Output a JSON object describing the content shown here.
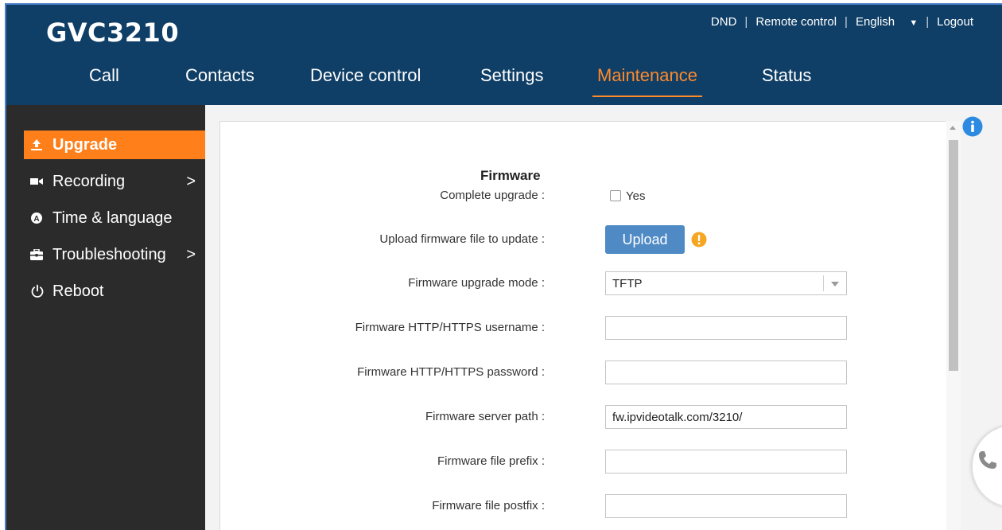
{
  "app": {
    "logo": "GVC3210"
  },
  "top_links": {
    "dnd": "DND",
    "remote_control": "Remote control",
    "language": "English",
    "logout": "Logout",
    "separator": "|"
  },
  "nav": {
    "tabs": [
      {
        "label": "Call"
      },
      {
        "label": "Contacts"
      },
      {
        "label": "Device control"
      },
      {
        "label": "Settings"
      },
      {
        "label": "Maintenance",
        "active": true
      },
      {
        "label": "Status"
      }
    ]
  },
  "sidebar": {
    "items": [
      {
        "label": "Upgrade",
        "icon": "upload-icon",
        "active": true
      },
      {
        "label": "Recording",
        "icon": "video-camera-icon",
        "has_submenu": true
      },
      {
        "label": "Time & language",
        "icon": "clock-icon"
      },
      {
        "label": "Troubleshooting",
        "icon": "toolbox-icon",
        "has_submenu": true
      },
      {
        "label": "Reboot",
        "icon": "power-icon"
      }
    ],
    "chevron": ">"
  },
  "form": {
    "section_title": "Firmware",
    "complete_upgrade": {
      "label": "Complete upgrade :",
      "option_text": "Yes",
      "checked": false
    },
    "upload_firmware": {
      "label": "Upload firmware file to update :",
      "button_label": "Upload"
    },
    "upgrade_mode": {
      "label": "Firmware upgrade mode :",
      "value": "TFTP"
    },
    "http_username": {
      "label": "Firmware HTTP/HTTPS username :",
      "value": ""
    },
    "http_password": {
      "label": "Firmware HTTP/HTTPS password :",
      "value": ""
    },
    "server_path": {
      "label": "Firmware server path :",
      "value": "fw.ipvideotalk.com/3210/"
    },
    "file_prefix": {
      "label": "Firmware file prefix :",
      "value": ""
    },
    "file_postfix": {
      "label": "Firmware file postfix :",
      "value": ""
    }
  },
  "colors": {
    "header_bg": "#0f3e66",
    "accent": "#ff7f1a",
    "sidebar_bg": "#2b2b2b",
    "button_blue": "#4f8ac5",
    "info_blue": "#2c8be0",
    "warning_orange": "#f5a623"
  }
}
